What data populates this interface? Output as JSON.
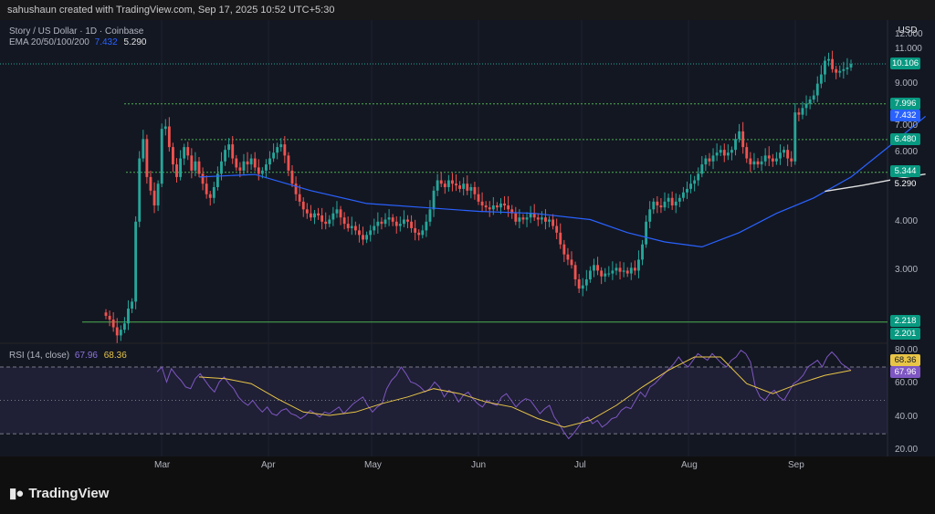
{
  "header": {
    "credit": "sahushaun created with TradingView.com, Sep 17, 2025 10:52 UTC+5:30"
  },
  "legend": {
    "symbol": "Story / US Dollar · 1D · Coinbase",
    "ema_label": "EMA 20/50/100/200",
    "ema_value_1": "7.432",
    "ema_value_2": "5.290"
  },
  "rsi_legend": {
    "label": "RSI (14, close)",
    "value_1": "67.96",
    "value_2": "68.36"
  },
  "axis": {
    "currency": "USD",
    "price_ticks": [
      "12.000",
      "11.000",
      "9.000",
      "7.000",
      "6.000",
      "4.000",
      "3.000"
    ],
    "rsi_ticks": [
      "80.00",
      "60.00",
      "40.00",
      "20.00"
    ],
    "months": [
      "Mar",
      "Apr",
      "May",
      "Jun",
      "Jul",
      "Aug",
      "Sep"
    ]
  },
  "price_tags": [
    {
      "text": "10.106",
      "color": "#089981"
    },
    {
      "text": "7.996",
      "color": "#089981"
    },
    {
      "text": "7.432",
      "color": "#2962ff"
    },
    {
      "text": "6.480",
      "color": "#089981"
    },
    {
      "text": "5.344",
      "color": "#089981"
    },
    {
      "text": "5.290",
      "color": "#131722"
    },
    {
      "text": "2.218",
      "color": "#089981"
    },
    {
      "text": "2.201",
      "color": "#089981"
    },
    {
      "text": "68.36",
      "color": "#e8c547"
    },
    {
      "text": "67.96",
      "color": "#7e57c2"
    }
  ],
  "brand": {
    "name": "TradingView",
    "logo": "tradingview-logo"
  },
  "colors": {
    "up": "#26a69a",
    "down": "#ef5350",
    "ema_fast": "#2962ff",
    "ema_slow": "#e0e0e0",
    "rsi": "#7e57c2",
    "rsi_ma": "#e8c547",
    "level": "#4caf50"
  },
  "chart_data": {
    "type": "candlestick",
    "title": "Story / US Dollar · 1D · Coinbase",
    "y_scale": "log",
    "ylim": [
      2.0,
      12.8
    ],
    "xlabels": [
      "Mar",
      "Apr",
      "May",
      "Jun",
      "Jul",
      "Aug",
      "Sep"
    ],
    "support_resistance_levels": [
      7.996,
      6.48,
      5.344,
      2.218
    ],
    "last_price": 10.106,
    "closes": [
      2.3,
      2.25,
      2.15,
      2.05,
      2.12,
      2.2,
      2.4,
      2.5,
      4.0,
      5.8,
      6.5,
      5.2,
      4.8,
      4.4,
      5.0,
      6.9,
      7.0,
      6.2,
      5.6,
      5.2,
      5.8,
      6.2,
      5.9,
      5.4,
      5.7,
      5.3,
      5.0,
      4.7,
      4.6,
      4.9,
      5.3,
      5.7,
      6.1,
      6.3,
      5.8,
      5.5,
      5.4,
      5.7,
      5.6,
      5.8,
      5.5,
      5.3,
      5.4,
      5.6,
      5.8,
      6.0,
      6.2,
      6.3,
      5.9,
      5.4,
      5.0,
      4.7,
      4.5,
      4.3,
      4.2,
      4.1,
      4.2,
      4.15,
      4.0,
      3.95,
      4.05,
      4.2,
      4.3,
      4.1,
      3.95,
      3.85,
      3.9,
      3.8,
      3.7,
      3.6,
      3.7,
      3.8,
      3.9,
      4.0,
      3.95,
      4.05,
      4.1,
      4.0,
      3.9,
      3.95,
      4.05,
      4.0,
      3.85,
      3.75,
      3.7,
      3.8,
      4.0,
      4.3,
      4.8,
      5.1,
      5.0,
      4.9,
      5.1,
      5.0,
      4.95,
      4.85,
      5.0,
      4.8,
      4.9,
      4.7,
      4.5,
      4.4,
      4.35,
      4.3,
      4.4,
      4.35,
      4.45,
      4.4,
      4.3,
      4.2,
      4.0,
      4.1,
      4.05,
      4.1,
      4.2,
      4.1,
      4.05,
      4.1,
      4.0,
      4.05,
      3.9,
      3.75,
      3.5,
      3.3,
      3.2,
      3.1,
      2.85,
      2.7,
      2.75,
      2.85,
      3.0,
      3.1,
      3.0,
      2.9,
      2.95,
      2.95,
      3.0,
      3.05,
      2.98,
      3.0,
      2.95,
      3.05,
      3.0,
      3.2,
      3.5,
      4.0,
      4.3,
      4.5,
      4.4,
      4.35,
      4.5,
      4.6,
      4.4,
      4.5,
      4.6,
      4.75,
      4.85,
      5.0,
      5.1,
      5.3,
      5.6,
      5.8,
      5.7,
      5.9,
      6.0,
      6.1,
      5.9,
      6.0,
      6.1,
      6.5,
      6.8,
      6.2,
      5.8,
      5.6,
      5.7,
      5.6,
      5.7,
      5.9,
      5.8,
      5.7,
      5.8,
      6.0,
      6.1,
      5.8,
      5.7,
      7.6,
      7.5,
      7.8,
      8.0,
      8.2,
      8.4,
      9.0,
      9.5,
      10.3,
      10.4,
      9.8,
      9.6,
      9.7,
      9.8,
      9.9,
      10.1
    ],
    "ema_fast": [
      [
        25,
        5.2
      ],
      [
        40,
        5.28
      ],
      [
        55,
        4.8
      ],
      [
        70,
        4.45
      ],
      [
        85,
        4.35
      ],
      [
        100,
        4.25
      ],
      [
        115,
        4.2
      ],
      [
        130,
        4.05
      ],
      [
        140,
        3.75
      ],
      [
        150,
        3.55
      ],
      [
        160,
        3.45
      ],
      [
        170,
        3.75
      ],
      [
        180,
        4.2
      ],
      [
        190,
        4.6
      ],
      [
        200,
        5.2
      ],
      [
        210,
        6.2
      ],
      [
        220,
        7.43
      ]
    ],
    "ema_slow": [
      [
        193,
        4.78
      ],
      [
        203,
        4.95
      ],
      [
        213,
        5.16
      ],
      [
        220,
        5.29
      ]
    ],
    "rsi": [
      67,
      70,
      61,
      69,
      65,
      62,
      58,
      57,
      63,
      66,
      62,
      58,
      55,
      61,
      64,
      60,
      57,
      52,
      49,
      47,
      50,
      46,
      43,
      46,
      42,
      41,
      44,
      45,
      42,
      41,
      39,
      41,
      44,
      42,
      40,
      43,
      42,
      44,
      46,
      42,
      45,
      48,
      50,
      52,
      47,
      43,
      46,
      48,
      57,
      62,
      65,
      70,
      66,
      61,
      60,
      58,
      55,
      57,
      61,
      58,
      52,
      56,
      54,
      49,
      53,
      55,
      51,
      48,
      46,
      50,
      48,
      47,
      52,
      54,
      50,
      46,
      49,
      51,
      50,
      46,
      42,
      45,
      47,
      40,
      36,
      31,
      27,
      30,
      34,
      38,
      40,
      36,
      38,
      34,
      36,
      39,
      40,
      44,
      46,
      45,
      50,
      55,
      52,
      58,
      60,
      63,
      66,
      69,
      72,
      76,
      72,
      70,
      74,
      78,
      76,
      74,
      78,
      75,
      72,
      70,
      74,
      76,
      80,
      78,
      73,
      58,
      52,
      50,
      54,
      56,
      52,
      50,
      55,
      60,
      62,
      65,
      70,
      72,
      74,
      70,
      76,
      79,
      76,
      72,
      70,
      68
    ],
    "rsi_ma": [
      [
        0,
        64
      ],
      [
        10,
        63
      ],
      [
        20,
        60
      ],
      [
        30,
        51
      ],
      [
        40,
        43
      ],
      [
        50,
        41
      ],
      [
        60,
        43
      ],
      [
        70,
        48
      ],
      [
        80,
        52
      ],
      [
        90,
        57
      ],
      [
        100,
        54
      ],
      [
        110,
        49
      ],
      [
        120,
        46
      ],
      [
        130,
        39
      ],
      [
        140,
        34
      ],
      [
        150,
        38
      ],
      [
        160,
        47
      ],
      [
        170,
        58
      ],
      [
        180,
        68
      ],
      [
        190,
        76
      ],
      [
        200,
        76
      ],
      [
        210,
        60
      ],
      [
        220,
        54
      ],
      [
        230,
        60
      ],
      [
        240,
        65
      ],
      [
        250,
        68
      ]
    ],
    "rsi_levels": [
      70,
      50,
      30
    ],
    "rsi_ylim": [
      18,
      82
    ]
  }
}
